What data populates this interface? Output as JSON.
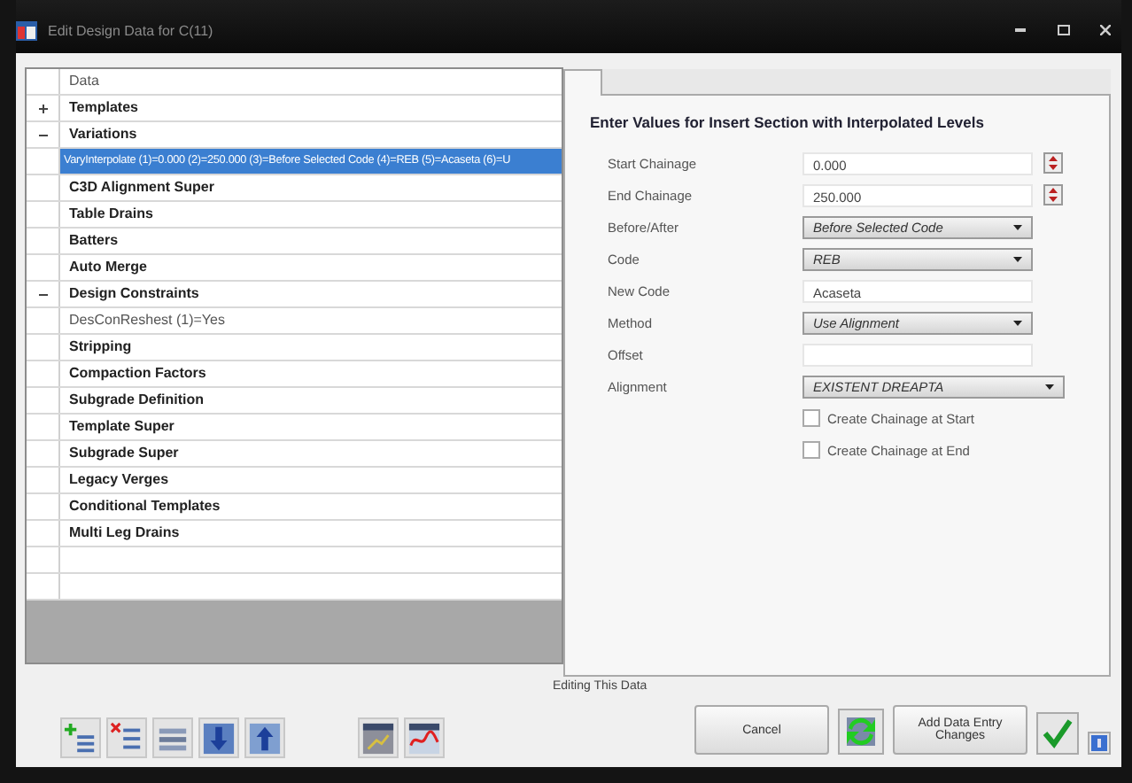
{
  "window": {
    "title": "Edit Design Data for C(11)"
  },
  "tree": {
    "header": "Data",
    "items": [
      {
        "label": "Templates",
        "expanded": false,
        "selected": false
      },
      {
        "label": "Variations",
        "expanded": true,
        "selected": false,
        "children": [
          {
            "label": "VaryInterpolate (1)=0.000 (2)=250.000 (3)=Before Selected Code (4)=REB (5)=Acaseta (6)=U",
            "selected": true
          }
        ]
      },
      {
        "label": "C3D Alignment Super",
        "selected": false
      },
      {
        "label": "Table Drains",
        "selected": false
      },
      {
        "label": "Batters",
        "selected": false
      },
      {
        "label": "Auto Merge",
        "selected": false
      },
      {
        "label": "Design Constraints",
        "expanded": true,
        "selected": false,
        "children": [
          {
            "label": "DesConReshest (1)=Yes",
            "selected": false
          }
        ]
      },
      {
        "label": "Stripping",
        "selected": false
      },
      {
        "label": "Compaction Factors",
        "selected": false
      },
      {
        "label": "Subgrade Definition",
        "selected": false
      },
      {
        "label": "Template Super",
        "selected": false
      },
      {
        "label": "Subgrade Super",
        "selected": false
      },
      {
        "label": "Legacy Verges",
        "selected": false
      },
      {
        "label": "Conditional Templates",
        "selected": false
      },
      {
        "label": "Multi Leg Drains",
        "selected": false
      }
    ]
  },
  "form": {
    "heading": "Enter Values for Insert Section with Interpolated Levels",
    "fields": [
      {
        "kind": "text",
        "label": "Start Chainage",
        "value": "0.000",
        "spinner": true
      },
      {
        "kind": "text",
        "label": "End Chainage",
        "value": "250.000",
        "spinner": true
      },
      {
        "kind": "dropdown",
        "label": "Before/After",
        "value": "Before Selected Code"
      },
      {
        "kind": "dropdown",
        "label": "Code",
        "value": "REB"
      },
      {
        "kind": "text",
        "label": "New Code",
        "value": "Acaseta",
        "spinner": false
      },
      {
        "kind": "dropdown",
        "label": "Method",
        "value": "Use Alignment"
      },
      {
        "kind": "text",
        "label": "Offset",
        "spinner": false
      },
      {
        "kind": "dropdown",
        "label": "Alignment",
        "value": "EXISTENT DREAPTA",
        "wide": true
      },
      {
        "kind": "checkbox",
        "label": "Create Chainage at Start",
        "checked": false
      },
      {
        "kind": "checkbox",
        "label": "Create Chainage at End",
        "checked": false
      }
    ]
  },
  "footer": {
    "status": "Editing This Data",
    "cancel": "Cancel",
    "apply": "Add Data Entry Changes"
  }
}
